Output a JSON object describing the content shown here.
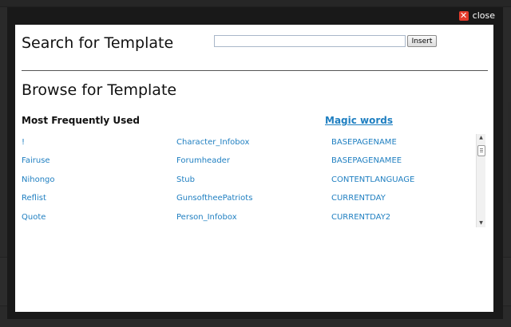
{
  "modal": {
    "close_label": "close"
  },
  "search": {
    "title": "Search for Template",
    "input_value": "",
    "insert_label": "Insert"
  },
  "browse": {
    "title": "Browse for Template",
    "most_frequent_heading": "Most Frequently Used",
    "magic_words_heading": "Magic words",
    "column_a": [
      "!",
      "Fairuse",
      "Nihongo",
      "Reflist",
      "Quote"
    ],
    "column_b": [
      "Character_Infobox",
      "Forumheader",
      "Stub",
      "GunsoftheePatriots",
      "Person_Infobox"
    ],
    "magic_words": [
      "BASEPAGENAME",
      "BASEPAGENAMEE",
      "CONTENTLANGUAGE",
      "CURRENTDAY",
      "CURRENTDAY2"
    ]
  },
  "icons": {
    "close": "close-icon",
    "scroll_up": "scroll-up-arrow-icon",
    "scroll_down": "scroll-down-arrow-icon"
  },
  "colors": {
    "link": "#1f7fc1",
    "close_icon": "#e43b2c",
    "modal_frame": "#191919"
  }
}
